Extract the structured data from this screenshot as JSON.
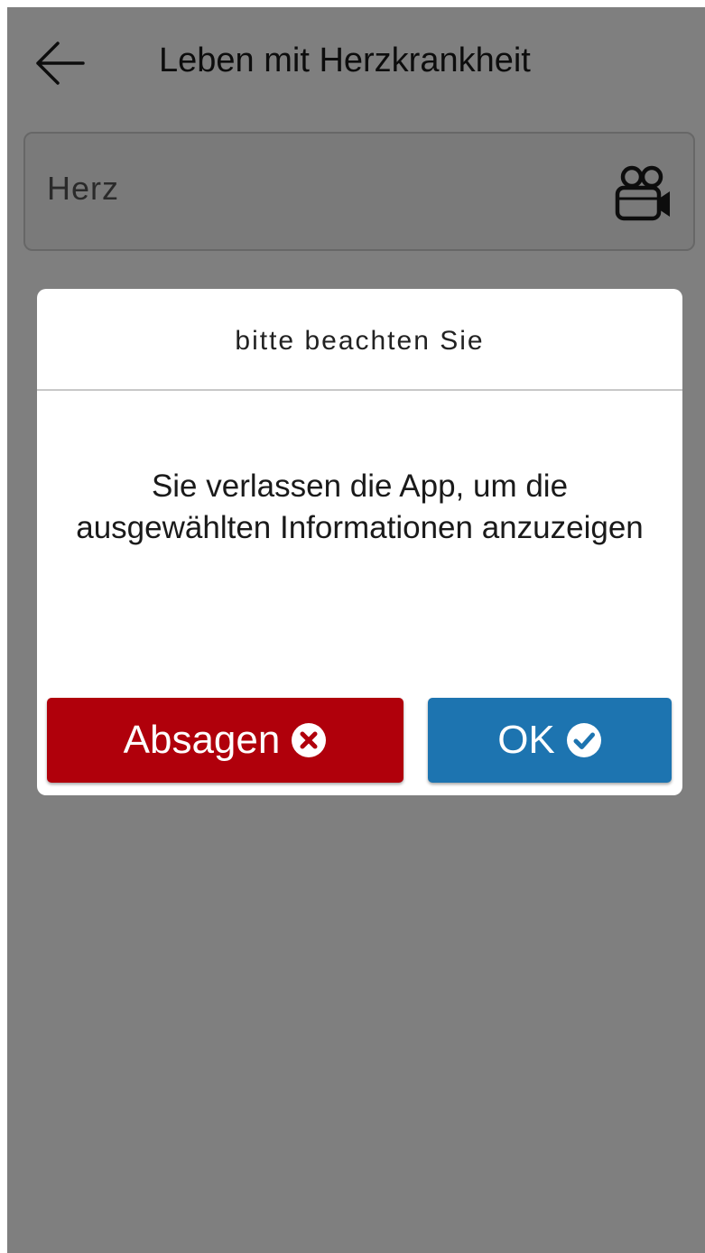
{
  "header": {
    "title": "Leben mit Herzkrankheit",
    "back_icon": "arrow-left-icon"
  },
  "search": {
    "value": "Herz",
    "video_icon": "video-camera-icon"
  },
  "dialog": {
    "title": "bitte beachten Sie",
    "message": "Sie verlassen die App, um die ausgewählten Informationen anzuzeigen",
    "cancel_label": "Absagen",
    "cancel_icon": "close-circle-icon",
    "ok_label": "OK",
    "ok_icon": "check-circle-icon"
  },
  "colors": {
    "cancel": "#b0000b",
    "ok": "#1d74b0",
    "overlay": "rgba(0,0,0,0.5)"
  }
}
